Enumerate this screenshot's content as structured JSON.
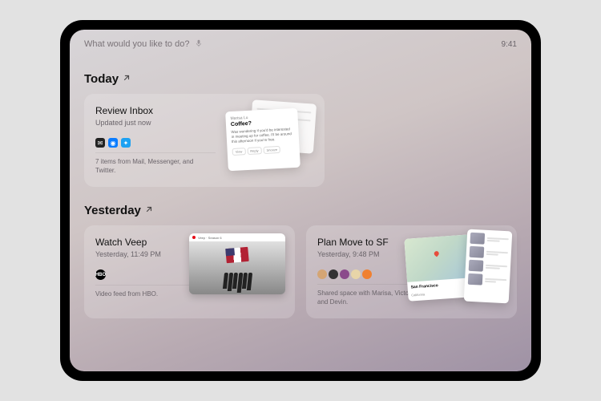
{
  "topbar": {
    "search_placeholder": "What would you like to do?",
    "clock": "9:41"
  },
  "sections": {
    "today": {
      "title": "Today",
      "cards": [
        {
          "title": "Review Inbox",
          "subtitle": "Updated just now",
          "footer": "7 items from Mail, Messenger, and Twitter.",
          "preview": {
            "sender": "Marisa Lu",
            "subject": "Coffee?",
            "body": "Was wondering if you'd be interested in meeting up for coffee. I'll be around this afternoon if you're free.",
            "pill_a": "View",
            "pill_b": "Reply",
            "pill_c": "Snooze"
          }
        }
      ]
    },
    "yesterday": {
      "title": "Yesterday",
      "cards": [
        {
          "title": "Watch Veep",
          "subtitle": "Yesterday, 11:49 PM",
          "footer": "Video feed from HBO.",
          "preview_bar": "Veep · Season 6"
        },
        {
          "title": "Plan Move to SF",
          "subtitle": "Yesterday, 9:48 PM",
          "footer": "Shared space with Marisa, Victoria, and Devin.",
          "map_label": "San Francisco",
          "map_sub": "California"
        }
      ]
    }
  }
}
